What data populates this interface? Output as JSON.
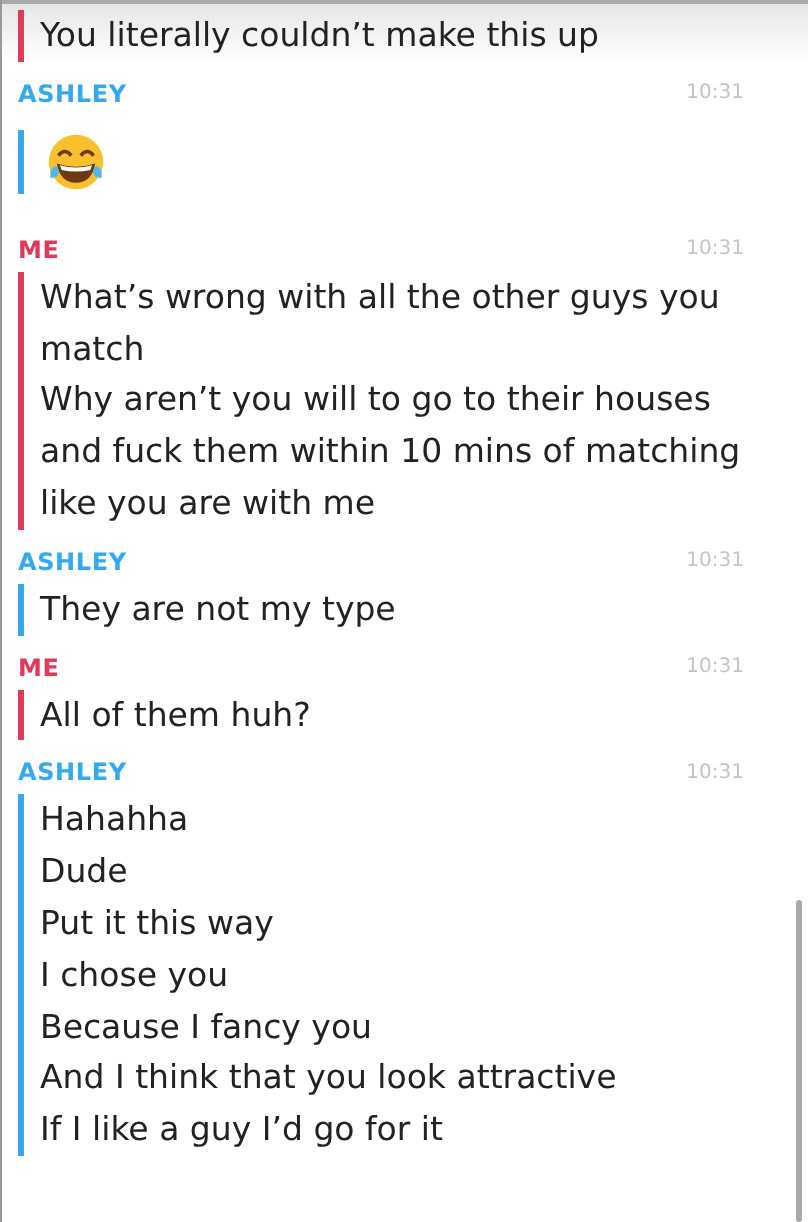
{
  "chat": [
    {
      "kind": "me",
      "messages": [
        {
          "kind": "text",
          "text": "You literally couldn’t make this up"
        }
      ]
    },
    {
      "kind": "friend",
      "sender": "ASHLEY",
      "time": "10:31",
      "messages": [
        {
          "kind": "emoji"
        }
      ]
    },
    {
      "kind": "me",
      "sender": "ME",
      "time": "10:31",
      "messages": [
        {
          "kind": "text",
          "text": "What’s wrong with all the other guys you match"
        },
        {
          "kind": "text",
          "text": "Why aren’t you will to go to their houses and fuck them within 10 mins of matching like you are with me"
        }
      ]
    },
    {
      "kind": "friend",
      "sender": "ASHLEY",
      "time": "10:31",
      "messages": [
        {
          "kind": "text",
          "text": "They are not my type"
        }
      ]
    },
    {
      "kind": "me",
      "sender": "ME",
      "time": "10:31",
      "messages": [
        {
          "kind": "text",
          "text": "All of them huh?"
        }
      ]
    },
    {
      "kind": "friend",
      "sender": "ASHLEY",
      "time": "10:31",
      "messages": [
        {
          "kind": "text",
          "text": "Hahahha"
        },
        {
          "kind": "text",
          "text": "Dude"
        },
        {
          "kind": "text",
          "text": "Put it this way"
        },
        {
          "kind": "text",
          "text": "I chose you"
        },
        {
          "kind": "text",
          "text": "Because I fancy you"
        },
        {
          "kind": "text",
          "text": "And I think that you look attractive"
        },
        {
          "kind": "text",
          "text": "If I like a guy I’d go for it"
        }
      ]
    }
  ]
}
